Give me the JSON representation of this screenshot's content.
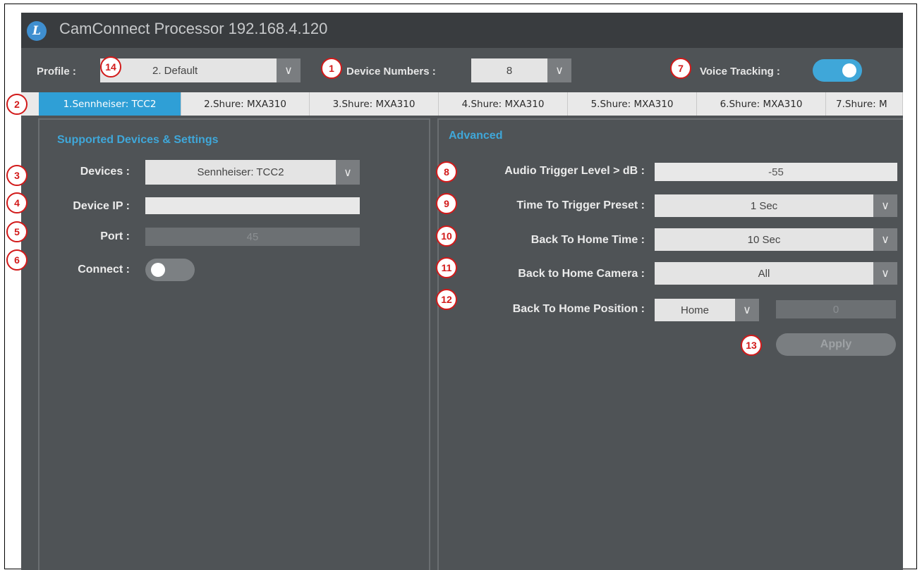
{
  "app": {
    "title": "CamConnect Processor 192.168.4.120",
    "logo_letter": "L"
  },
  "topbar": {
    "profile_label": "Profile :",
    "profile_value": "2. Default",
    "device_numbers_label": "Device Numbers :",
    "device_numbers_value": "8",
    "voice_tracking_label": "Voice Tracking :",
    "voice_tracking_on": true
  },
  "tabs": [
    {
      "label": "1.Sennheiser: TCC2",
      "active": true
    },
    {
      "label": "2.Shure: MXA310"
    },
    {
      "label": "3.Shure: MXA310"
    },
    {
      "label": "4.Shure: MXA310"
    },
    {
      "label": "5.Shure: MXA310"
    },
    {
      "label": "6.Shure: MXA310"
    },
    {
      "label": "7.Shure: M"
    }
  ],
  "left_panel": {
    "title": "Supported Devices & Settings",
    "devices_label": "Devices :",
    "devices_value": "Sennheiser: TCC2",
    "device_ip_label": "Device IP :",
    "device_ip_value": "",
    "port_label": "Port :",
    "port_value": "45",
    "connect_label": "Connect :",
    "connect_on": false
  },
  "right_panel": {
    "title": "Advanced",
    "audio_trigger_label": "Audio Trigger Level > dB :",
    "audio_trigger_value": "-55",
    "time_to_trigger_label": "Time To Trigger Preset :",
    "time_to_trigger_value": "1 Sec",
    "back_home_time_label": "Back To Home Time :",
    "back_home_time_value": "10 Sec",
    "back_home_camera_label": "Back to Home Camera :",
    "back_home_camera_value": "All",
    "back_home_position_label": "Back To Home Position :",
    "back_home_position_value": "Home",
    "back_home_position_number": "0",
    "apply_label": "Apply"
  },
  "icons": {
    "dropdown_arrow": "chevron-down-icon"
  },
  "colors": {
    "accent": "#2f9fd6",
    "callout": "#d21a1a",
    "panel": "#4f5356"
  },
  "callouts": [
    "14",
    "1",
    "7",
    "2",
    "3",
    "4",
    "5",
    "6",
    "8",
    "9",
    "10",
    "11",
    "12",
    "13"
  ]
}
